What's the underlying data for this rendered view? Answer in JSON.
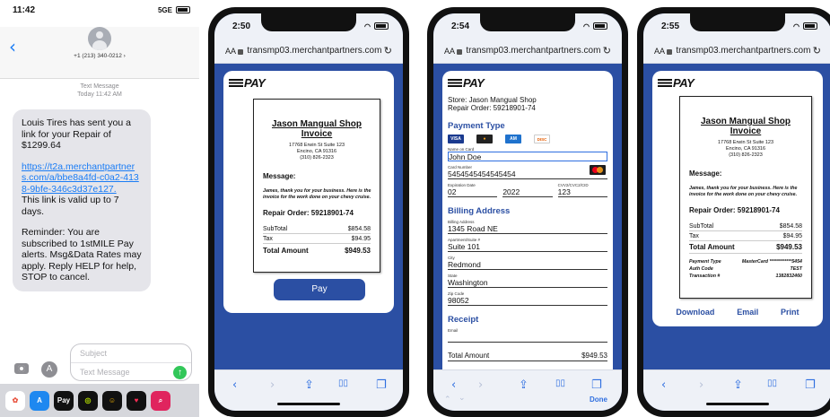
{
  "messages": {
    "time": "11:42",
    "network": "5GE",
    "back_glyph": "‹",
    "phone_number": "+1 (213) 340-0212",
    "chevron": "›",
    "thread_type": "Text Message",
    "thread_time": "Today 11:42 AM",
    "bubble": {
      "intro": "Louis Tires has sent you a link for your Repair of $1299.64",
      "link": "https://t2a.merchantpartners.com/a/bbe8a4fd-c0a2-4138-9bfe-346c3d37e127.",
      "validity": "This link is valid up to 7 days.",
      "reminder": "Reminder: You are subscribed to 1stMILE Pay alerts. Msg&Data Rates may apply. Reply HELP for help, STOP to cancel."
    },
    "compose": {
      "subject_placeholder": "Subject",
      "message_placeholder": "Text Message",
      "send_glyph": "↑",
      "apps_glyph": "A"
    },
    "app_icons": [
      {
        "name": "photos-app-icon",
        "color": "#ffffff",
        "label": "✿",
        "fg": "#e8533f"
      },
      {
        "name": "app-store-icon",
        "color": "#1e88f0",
        "label": "A",
        "fg": "#ffffff"
      },
      {
        "name": "apple-pay-icon",
        "color": "#111111",
        "label": "Pay",
        "fg": "#ffffff"
      },
      {
        "name": "activity-icon",
        "color": "#111111",
        "label": "◎",
        "fg": "#b5e000"
      },
      {
        "name": "memoji-icon",
        "color": "#111111",
        "label": "☺",
        "fg": "#f4b400"
      },
      {
        "name": "digital-touch-icon",
        "color": "#111111",
        "label": "♥",
        "fg": "#ff2d55"
      },
      {
        "name": "search-images-icon",
        "color": "#e0245e",
        "label": "⌕",
        "fg": "#ffffff"
      }
    ]
  },
  "browser": {
    "aa": "AA",
    "url": "transmp03.merchantpartners.com",
    "reload_glyph": "↻",
    "nav": {
      "back": "‹",
      "forward": "›",
      "share": "⇪",
      "bookmarks": "▯▯",
      "tabs": "❐"
    }
  },
  "logo": "PAY",
  "invoice": {
    "shop": "Jason Mangual Shop",
    "title": "Invoice",
    "addr1": "17768 Erwin St Suite 123",
    "addr2": "Encino, CA 91316",
    "addr3": "(310) 826-2323",
    "message_label": "Message:",
    "message_text": "James, thank you for your business. Here is the invoice for the work done on your chevy cruise.",
    "repair_order": "Repair Order: 59218901-74",
    "subtotal_label": "SubTotal",
    "subtotal": "$854.58",
    "tax_label": "Tax",
    "tax": "$94.95",
    "total_label": "Total Amount",
    "total": "$949.53"
  },
  "panel2": {
    "time": "2:50",
    "pay_button": "Pay"
  },
  "panel3": {
    "time": "2:54",
    "store": "Store: Jason Mangual Shop",
    "repair_order": "Repair Order: 59218901-74",
    "payment_type": "Payment Type",
    "cards": [
      "VISA",
      "MC",
      "AMEX",
      "DISC"
    ],
    "name_label": "Name on Card",
    "name": "John Doe",
    "card_label": "Card Number",
    "card_number": "5454545454545454",
    "exp_label": "Expiration Date",
    "exp_month": "02",
    "exp_year": "2022",
    "cvv_label": "CVV2/CVC2/CID",
    "cvv": "123",
    "billing": "Billing Address",
    "billing_label": "Billing Address",
    "billing_addr": "1345 Road NE",
    "apt_label": "Apartment/Suite #",
    "apt": "Suite 101",
    "city_label": "City",
    "city": "Redmond",
    "state_label": "State",
    "state": "Washington",
    "zip_label": "Zip Code",
    "zip": "98052",
    "receipt": "Receipt",
    "email_label": "Email",
    "total_label": "Total Amount",
    "total": "$949.53",
    "done": "Done",
    "up": "⌃",
    "down": "⌄"
  },
  "panel4": {
    "time": "2:55",
    "payment_type_label": "Payment Type",
    "payment_type_value": "MasterCard ************5454",
    "auth_label": "Auth Code",
    "auth_value": "TEST",
    "txn_label": "Transaction #",
    "txn_value": "1382832460",
    "download": "Download",
    "email": "Email",
    "print": "Print"
  }
}
